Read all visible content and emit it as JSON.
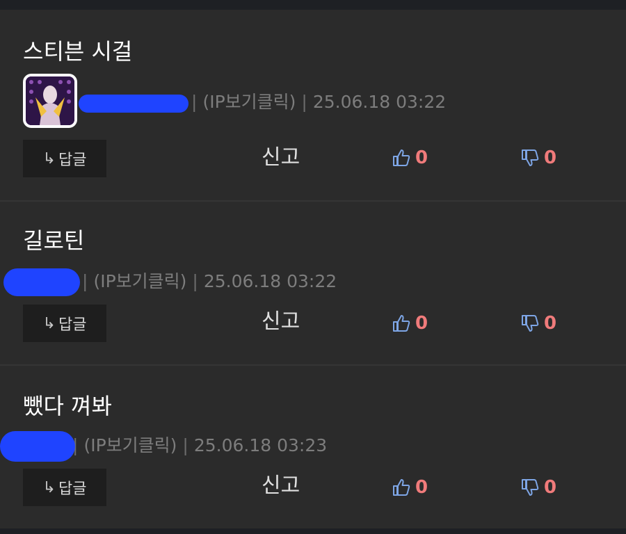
{
  "colors": {
    "background": "#2b2b2b",
    "accent_count": "#f07b7b",
    "thumb": "#7ea6e6",
    "redaction": "#1f44ff"
  },
  "comments": [
    {
      "title": "스티븐 시걸",
      "author": "",
      "ip_label": "(IP보기클릭)",
      "timestamp": "25.06.18 03:22",
      "has_avatar": true,
      "reply_label": "답글",
      "report_label": "신고",
      "likes": "0",
      "dislikes": "0"
    },
    {
      "title": "길로틴",
      "author": "",
      "ip_label": "(IP보기클릭)",
      "timestamp": "25.06.18 03:22",
      "has_avatar": false,
      "reply_label": "답글",
      "report_label": "신고",
      "likes": "0",
      "dislikes": "0"
    },
    {
      "title": "뺐다 껴봐",
      "author": "",
      "ip_label": "(IP보기클릭)",
      "timestamp": "25.06.18 03:23",
      "has_avatar": false,
      "reply_label": "답글",
      "report_label": "신고",
      "likes": "0",
      "dislikes": "0"
    }
  ],
  "icons": {
    "reply": "reply-arrow-icon",
    "like": "thumbs-up-icon",
    "dislike": "thumbs-down-icon"
  }
}
